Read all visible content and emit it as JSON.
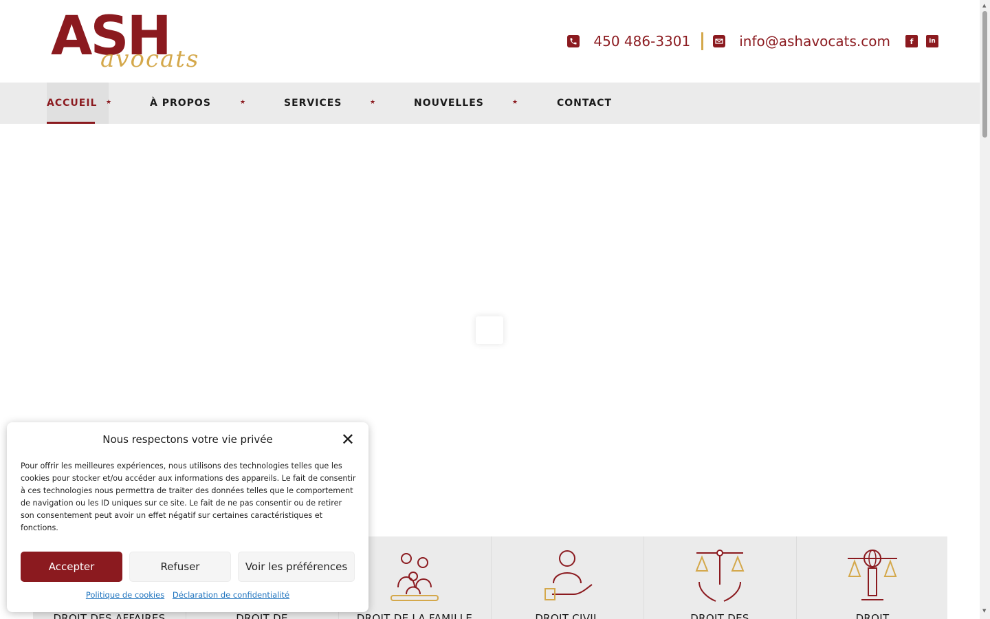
{
  "brand": {
    "logo_main": "ASH",
    "logo_sub": "avocats",
    "primary_color": "#8b1a1f",
    "accent_color": "#d4a84b"
  },
  "header": {
    "phone": "450 486-3301",
    "email": "info@ashavocats.com",
    "phone_icon": "phone-icon",
    "email_icon": "envelope-icon",
    "social": [
      {
        "name": "facebook-icon",
        "glyph": "f"
      },
      {
        "name": "linkedin-icon",
        "glyph": "in"
      }
    ]
  },
  "nav": {
    "items": [
      {
        "label": "ACCUEIL",
        "active": true
      },
      {
        "label": "À PROPOS",
        "active": false
      },
      {
        "label": "SERVICES",
        "active": false
      },
      {
        "label": "NOUVELLES",
        "active": false
      },
      {
        "label": "CONTACT",
        "active": false
      }
    ],
    "separator": "★"
  },
  "services": [
    {
      "label": "DROIT DES AFFAIRES",
      "icon": "business-icon"
    },
    {
      "label": "DROIT DE",
      "icon": "law-icon"
    },
    {
      "label": "DROIT DE LA FAMILLE",
      "icon": "family-icon"
    },
    {
      "label": "DROIT CIVIL",
      "icon": "person-hand-icon"
    },
    {
      "label": "DROIT DES",
      "icon": "scales-hands-icon"
    },
    {
      "label": "DROIT",
      "icon": "globe-scales-icon"
    }
  ],
  "cookie": {
    "title": "Nous respectons votre vie privée",
    "body": "Pour offrir les meilleures expériences, nous utilisons des technologies telles que les cookies pour stocker et/ou accéder aux informations des appareils. Le fait de consentir à ces technologies nous permettra de traiter des données telles que le comportement de navigation ou les ID uniques sur ce site. Le fait de ne pas consentir ou de retirer son consentement peut avoir un effet négatif sur certaines caractéristiques et fonctions.",
    "accept": "Accepter",
    "refuse": "Refuser",
    "preferences": "Voir les préférences",
    "link_cookies": "Politique de cookies",
    "link_privacy": "Déclaration de confidentialité"
  }
}
